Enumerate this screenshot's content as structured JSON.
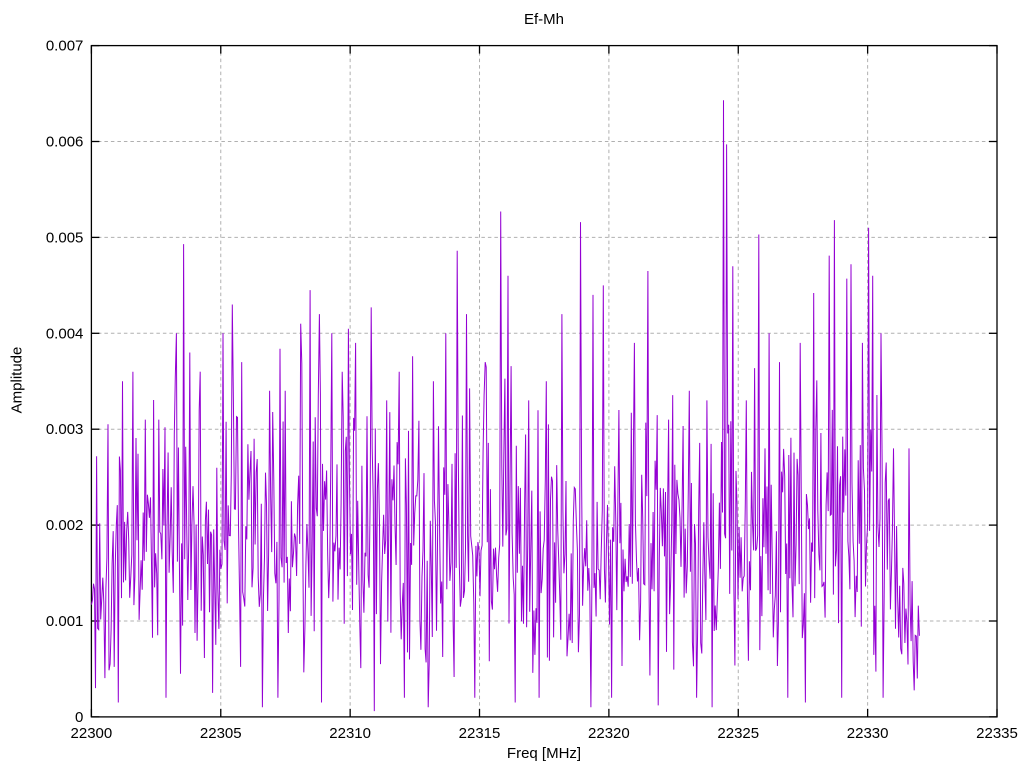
{
  "window": {
    "background": "#ffffff"
  },
  "chart_data": {
    "type": "line",
    "title": "Ef-Mh",
    "xlabel": "Freq [MHz]",
    "ylabel": "Amplitude",
    "xlim": [
      22300,
      22335
    ],
    "ylim": [
      0,
      0.007
    ],
    "x_ticks": [
      22300,
      22305,
      22310,
      22315,
      22320,
      22325,
      22330,
      22335
    ],
    "x_tick_labels": [
      "22300",
      "22305",
      "22310",
      "22315",
      "22320",
      "22325",
      "22330",
      "22335"
    ],
    "y_ticks": [
      0,
      0.001,
      0.002,
      0.003,
      0.004,
      0.005,
      0.006,
      0.007
    ],
    "y_tick_labels": [
      "0",
      "0.001",
      "0.002",
      "0.003",
      "0.004",
      "0.005",
      "0.006",
      "0.007"
    ],
    "grid": true,
    "grid_style": "dashed",
    "legend": "none",
    "colors": {
      "trace": "#9400d3",
      "grid": "#b0b0b0",
      "axis": "#000000",
      "text": "#000000"
    },
    "series": [
      {
        "name": "Ef-Mh",
        "x_start": 22300,
        "x_end": 22332,
        "n_points": 800,
        "noise": {
          "seed": 1337,
          "base": 0.0002,
          "tri": 0.00125,
          "skew": 0.0018
        },
        "envelope": [
          [
            22300,
            0.72
          ],
          [
            22300.6,
            1
          ],
          [
            22330.8,
            1
          ],
          [
            22331.4,
            0.62
          ],
          [
            22332,
            0.4
          ]
        ],
        "peaks": [
          [
            22301.2,
            0.0035
          ],
          [
            22301.6,
            0.0036
          ],
          [
            22302.1,
            0.0031
          ],
          [
            22302.6,
            0.0031
          ],
          [
            22303.3,
            0.004
          ],
          [
            22303.55,
            0.00493
          ],
          [
            22303.8,
            0.0038
          ],
          [
            22304.2,
            0.0036
          ],
          [
            22305.1,
            0.004
          ],
          [
            22305.45,
            0.0043
          ],
          [
            22305.8,
            0.0037
          ],
          [
            22306.3,
            0.0029
          ],
          [
            22306.9,
            0.0034
          ],
          [
            22307.5,
            0.0034
          ],
          [
            22308.1,
            0.0041
          ],
          [
            22308.45,
            0.00445
          ],
          [
            22308.8,
            0.0042
          ],
          [
            22309.3,
            0.004
          ],
          [
            22309.7,
            0.0036
          ],
          [
            22310.2,
            0.0039
          ],
          [
            22310.8,
            0.00427
          ],
          [
            22311.4,
            0.0033
          ],
          [
            22311.9,
            0.0036
          ],
          [
            22312.4,
            0.00376
          ],
          [
            22313.2,
            0.0035
          ],
          [
            22313.7,
            0.004
          ],
          [
            22314.15,
            0.00486
          ],
          [
            22314.5,
            0.0042
          ],
          [
            22315.2,
            0.0037
          ],
          [
            22315.8,
            0.00527
          ],
          [
            22316.1,
            0.0046
          ],
          [
            22316.9,
            0.0033
          ],
          [
            22317.6,
            0.0035
          ],
          [
            22318.2,
            0.0042
          ],
          [
            22318.9,
            0.00516
          ],
          [
            22319.4,
            0.0044
          ],
          [
            22319.8,
            0.0045
          ],
          [
            22320.4,
            0.0032
          ],
          [
            22321.0,
            0.0039
          ],
          [
            22321.5,
            0.00465
          ],
          [
            22322.3,
            0.0031
          ],
          [
            22323.1,
            0.0034
          ],
          [
            22323.8,
            0.0033
          ],
          [
            22324.45,
            0.00643
          ],
          [
            22324.55,
            0.00597
          ],
          [
            22324.8,
            0.0047
          ],
          [
            22325.3,
            0.0033
          ],
          [
            22325.8,
            0.00503
          ],
          [
            22326.2,
            0.004
          ],
          [
            22326.6,
            0.0037
          ],
          [
            22327.4,
            0.0039
          ],
          [
            22327.9,
            0.00442
          ],
          [
            22328.5,
            0.00481
          ],
          [
            22328.7,
            0.00518
          ],
          [
            22329.2,
            0.00457
          ],
          [
            22329.35,
            0.00472
          ],
          [
            22329.8,
            0.0039
          ],
          [
            22330.05,
            0.0051
          ],
          [
            22330.2,
            0.0046
          ],
          [
            22330.5,
            0.004
          ],
          [
            22331.0,
            0.0028
          ],
          [
            22331.6,
            0.0028
          ]
        ],
        "dips": [
          [
            22300.15,
            0.0003
          ],
          [
            22301.05,
            0.00015
          ],
          [
            22302.9,
            0.0002
          ],
          [
            22304.7,
            0.00025
          ],
          [
            22306.6,
            0.0001
          ],
          [
            22307.2,
            0.0002
          ],
          [
            22308.9,
            0.00015
          ],
          [
            22310.95,
            6e-05
          ],
          [
            22312.1,
            0.0002
          ],
          [
            22313.0,
            0.0001
          ],
          [
            22314.8,
            0.0002
          ],
          [
            22316.4,
            0.00015
          ],
          [
            22317.3,
            0.0002
          ],
          [
            22319.3,
            0.0001
          ],
          [
            22320.1,
            0.0002
          ],
          [
            22321.9,
            0.00012
          ],
          [
            22323.4,
            0.0002
          ],
          [
            22324.0,
            0.0001
          ],
          [
            22326.9,
            0.0002
          ],
          [
            22327.6,
            0.00015
          ],
          [
            22329.0,
            0.0002
          ],
          [
            22330.6,
            0.0002
          ],
          [
            22331.9,
            0.0004
          ]
        ]
      }
    ]
  }
}
